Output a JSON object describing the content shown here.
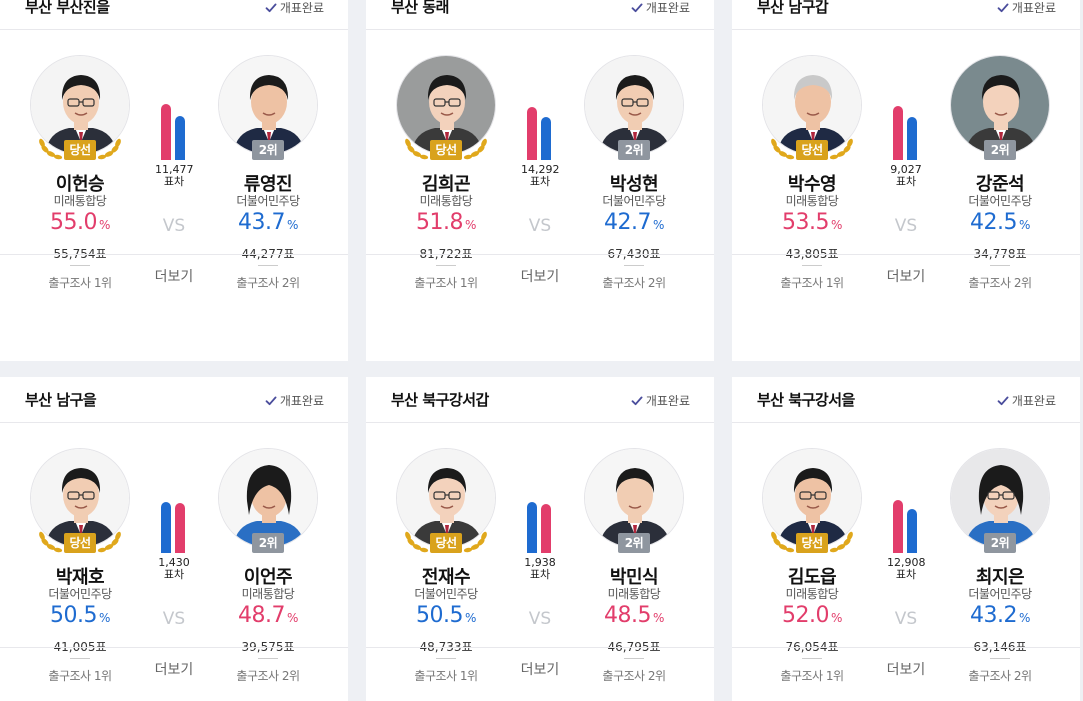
{
  "status_label": "개표완료",
  "more_label": "더보기",
  "gap_unit": "표차",
  "vs_label": "VS",
  "pct_unit": "%",
  "colors": {
    "mirae": "#e23d6b",
    "minju": "#1e6bd0",
    "win_badge": "#d9a21c",
    "second_badge": "#8f969f"
  },
  "cards": [
    {
      "district": "부산 부산진을",
      "gap": "11,477",
      "left": {
        "badge": "당선",
        "name": "이헌승",
        "party": "미래통합당",
        "pct": "55.0",
        "votes": "55,754표",
        "exit": "출구조사 1위",
        "color": "red"
      },
      "right": {
        "badge": "2위",
        "name": "류영진",
        "party": "더불어민주당",
        "pct": "43.7",
        "votes": "44,277표",
        "exit": "출구조사 2위",
        "color": "blue"
      }
    },
    {
      "district": "부산 동래",
      "gap": "14,292",
      "left": {
        "badge": "당선",
        "name": "김희곤",
        "party": "미래통합당",
        "pct": "51.8",
        "votes": "81,722표",
        "exit": "출구조사 1위",
        "color": "red"
      },
      "right": {
        "badge": "2위",
        "name": "박성현",
        "party": "더불어민주당",
        "pct": "42.7",
        "votes": "67,430표",
        "exit": "출구조사 2위",
        "color": "blue"
      }
    },
    {
      "district": "부산 남구갑",
      "gap": "9,027",
      "left": {
        "badge": "당선",
        "name": "박수영",
        "party": "미래통합당",
        "pct": "53.5",
        "votes": "43,805표",
        "exit": "출구조사 1위",
        "color": "red"
      },
      "right": {
        "badge": "2위",
        "name": "강준석",
        "party": "더불어민주당",
        "pct": "42.5",
        "votes": "34,778표",
        "exit": "출구조사 2위",
        "color": "blue"
      }
    },
    {
      "district": "부산 남구을",
      "gap": "1,430",
      "left": {
        "badge": "당선",
        "name": "박재호",
        "party": "더불어민주당",
        "pct": "50.5",
        "votes": "41,005표",
        "exit": "출구조사 1위",
        "color": "blue"
      },
      "right": {
        "badge": "2위",
        "name": "이언주",
        "party": "미래통합당",
        "pct": "48.7",
        "votes": "39,575표",
        "exit": "출구조사 2위",
        "color": "red"
      }
    },
    {
      "district": "부산 북구강서갑",
      "gap": "1,938",
      "left": {
        "badge": "당선",
        "name": "전재수",
        "party": "더불어민주당",
        "pct": "50.5",
        "votes": "48,733표",
        "exit": "출구조사 1위",
        "color": "blue"
      },
      "right": {
        "badge": "2위",
        "name": "박민식",
        "party": "미래통합당",
        "pct": "48.5",
        "votes": "46,795표",
        "exit": "출구조사 2위",
        "color": "red"
      }
    },
    {
      "district": "부산 북구강서을",
      "gap": "12,908",
      "left": {
        "badge": "당선",
        "name": "김도읍",
        "party": "미래통합당",
        "pct": "52.0",
        "votes": "76,054표",
        "exit": "출구조사 1위",
        "color": "red"
      },
      "right": {
        "badge": "2위",
        "name": "최지은",
        "party": "더불어민주당",
        "pct": "43.2",
        "votes": "63,146표",
        "exit": "출구조사 2위",
        "color": "blue"
      }
    }
  ]
}
